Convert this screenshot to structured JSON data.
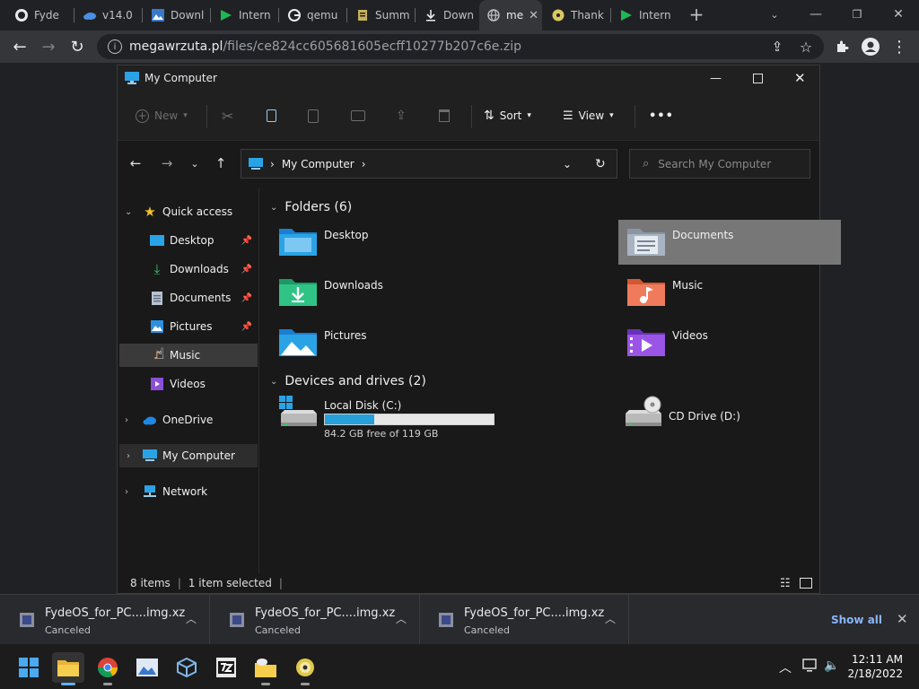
{
  "browser": {
    "tabs": [
      {
        "label": "Fyde",
        "icon": "github-icon"
      },
      {
        "label": "v14.0",
        "icon": "cloud-icon"
      },
      {
        "label": "Downl",
        "icon": "image-icon"
      },
      {
        "label": "Intern",
        "icon": "play-triangle-icon"
      },
      {
        "label": "qemu",
        "icon": "google-icon"
      },
      {
        "label": "Summ",
        "icon": "document-icon"
      },
      {
        "label": "Down",
        "icon": "download-icon"
      },
      {
        "label": "me",
        "icon": "globe-icon",
        "active": true
      },
      {
        "label": "Thank",
        "icon": "disc-icon"
      },
      {
        "label": "Intern",
        "icon": "play-triangle-icon"
      }
    ],
    "url_host": "megawrzuta.pl",
    "url_path": "/files/ce824cc605681605ecff10277b207c6e.zip"
  },
  "explorer": {
    "title": "My Computer",
    "commands": {
      "new": "New",
      "sort": "Sort",
      "view": "View",
      "more": "•••"
    },
    "address": "My Computer",
    "search_placeholder": "Search My Computer",
    "sidebar": {
      "quick_access": "Quick access",
      "items": [
        {
          "label": "Desktop",
          "pinned": true
        },
        {
          "label": "Downloads",
          "pinned": true
        },
        {
          "label": "Documents",
          "pinned": true
        },
        {
          "label": "Pictures",
          "pinned": true
        },
        {
          "label": "Music",
          "pinned": false,
          "selected": true
        },
        {
          "label": "Videos",
          "pinned": false
        }
      ],
      "onedrive": "OneDrive",
      "my_computer": "My Computer",
      "network": "Network"
    },
    "folders_header": "Folders (6)",
    "folders": [
      {
        "label": "Desktop"
      },
      {
        "label": "Documents",
        "selected": true
      },
      {
        "label": "Downloads"
      },
      {
        "label": "Music"
      },
      {
        "label": "Pictures"
      },
      {
        "label": "Videos"
      }
    ],
    "drives_header": "Devices and drives (2)",
    "drives": [
      {
        "label": "Local Disk (C:)",
        "free_text": "84.2 GB free of 119 GB",
        "used_fraction": 0.29
      },
      {
        "label": "CD Drive (D:)"
      }
    ],
    "status": {
      "items": "8 items",
      "selected": "1 item selected"
    }
  },
  "downloads": [
    {
      "file": "FydeOS_for_PC....img.xz",
      "status": "Canceled"
    },
    {
      "file": "FydeOS_for_PC....img.xz",
      "status": "Canceled"
    },
    {
      "file": "FydeOS_for_PC....img.xz",
      "status": "Canceled"
    }
  ],
  "shelf_show_all": "Show all",
  "taskbar": {
    "time": "12:11 AM",
    "date": "2/18/2022"
  },
  "colors": {
    "accent": "#26a0da",
    "show_all": "#8ab4f8"
  }
}
